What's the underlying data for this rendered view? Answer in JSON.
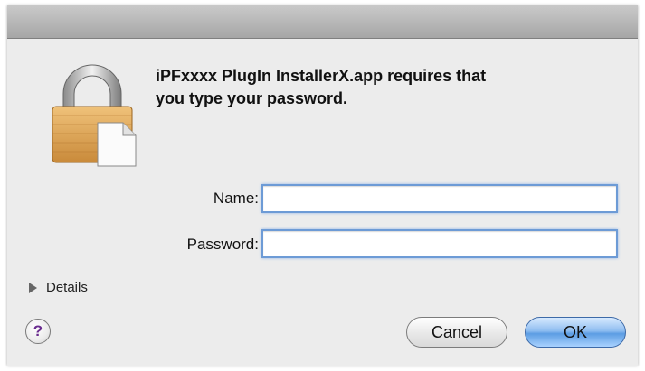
{
  "dialog": {
    "message": "iPFxxxx  PlugIn InstallerX.app requires that\nyou type your password.",
    "name_label": "Name:",
    "name_value": "",
    "password_label": "Password:",
    "password_value": "",
    "details_label": "Details",
    "help_label": "?",
    "cancel_label": "Cancel",
    "ok_label": "OK"
  },
  "icons": {
    "lock": "lock-document-icon",
    "details": "disclosure-triangle-icon",
    "help": "help-icon"
  },
  "colors": {
    "window_bg": "#ececec",
    "focus_blue": "#6d9bd6",
    "ok_button": "#5c9de3",
    "help_glyph": "#6a2d8f"
  }
}
